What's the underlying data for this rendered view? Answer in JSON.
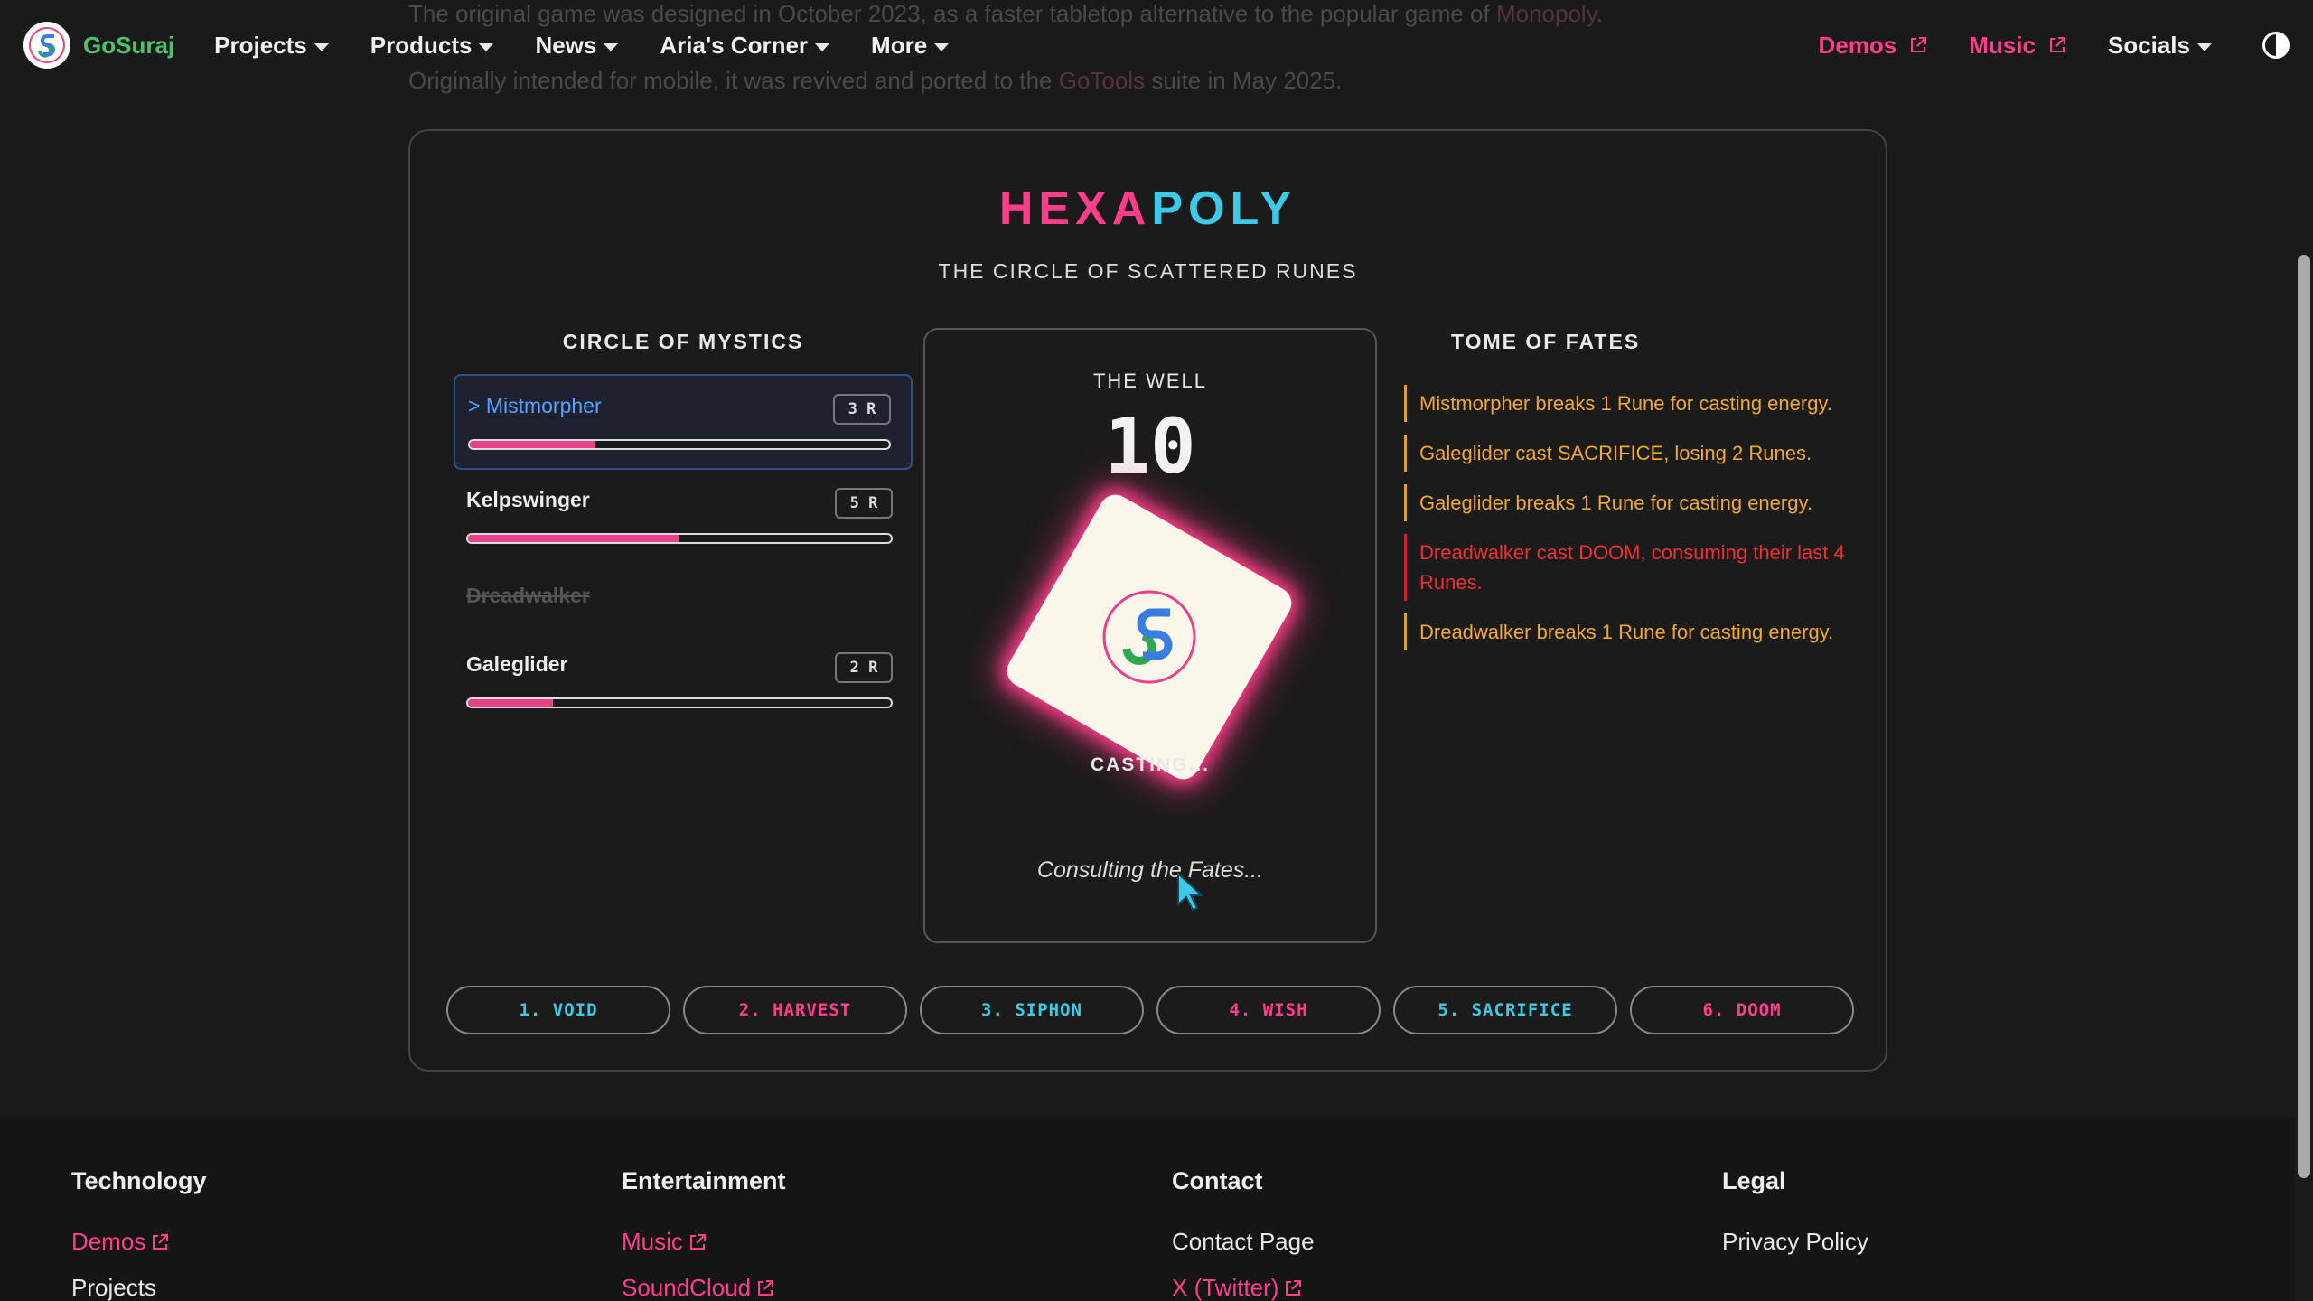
{
  "intro": {
    "line1_pre": "The original game was designed in October 2023, as a faster tabletop alternative to the popular game of ",
    "line1_link": "Monopoly",
    "line1_post": ".",
    "line2_pre": "Originally intended for mobile, it was revived and ported to the ",
    "line2_link": "GoTools",
    "line2_post": " suite in May 2025."
  },
  "nav": {
    "brand": "GoSuraj",
    "items": [
      "Projects",
      "Products",
      "News",
      "Aria's Corner",
      "More"
    ],
    "right": {
      "demos": "Demos",
      "music": "Music",
      "socials": "Socials"
    }
  },
  "game": {
    "title_a": "HEXA",
    "title_b": "POLY",
    "subtitle": "THE CIRCLE OF SCATTERED RUNES",
    "players_heading": "CIRCLE OF MYSTICS",
    "players": [
      {
        "name": "> Mistmorpher",
        "runes": "3 R",
        "health": 0.3
      },
      {
        "name": "Kelpswinger",
        "runes": "5 R",
        "health": 0.5
      },
      {
        "name": "Dreadwalker"
      },
      {
        "name": "Galeglider",
        "runes": "2 R",
        "health": 0.2
      }
    ],
    "well": {
      "label": "THE WELL",
      "count": "10",
      "casting": "CASTING...",
      "consult": "Consulting the Fates..."
    },
    "tome_heading": "TOME OF FATES",
    "log": [
      "Mistmorpher breaks 1 Rune for casting energy.",
      "Galeglider cast SACRIFICE, losing 2 Runes.",
      "Galeglider breaks 1 Rune for casting energy.",
      "Dreadwalker cast DOOM, consuming their last 4 Runes.",
      "Dreadwalker breaks 1 Rune for casting energy."
    ],
    "actions": [
      "1. VOID",
      "2. HARVEST",
      "3. SIPHON",
      "4. WISH",
      "5. SACRIFICE",
      "6. DOOM"
    ]
  },
  "footer": {
    "technology": {
      "heading": "Technology",
      "links": [
        "Demos",
        "Projects"
      ]
    },
    "entertainment": {
      "heading": "Entertainment",
      "links": [
        "Music",
        "SoundCloud"
      ]
    },
    "contact": {
      "heading": "Contact",
      "links": [
        "Contact Page",
        "X (Twitter)"
      ]
    },
    "legal": {
      "heading": "Legal",
      "links": [
        "Privacy Policy"
      ]
    }
  },
  "colors": {
    "accent_pink": "#ff3d8a",
    "accent_cyan": "#3ec9e6",
    "log_orange": "#f0a830",
    "log_red": "#ef3030"
  }
}
